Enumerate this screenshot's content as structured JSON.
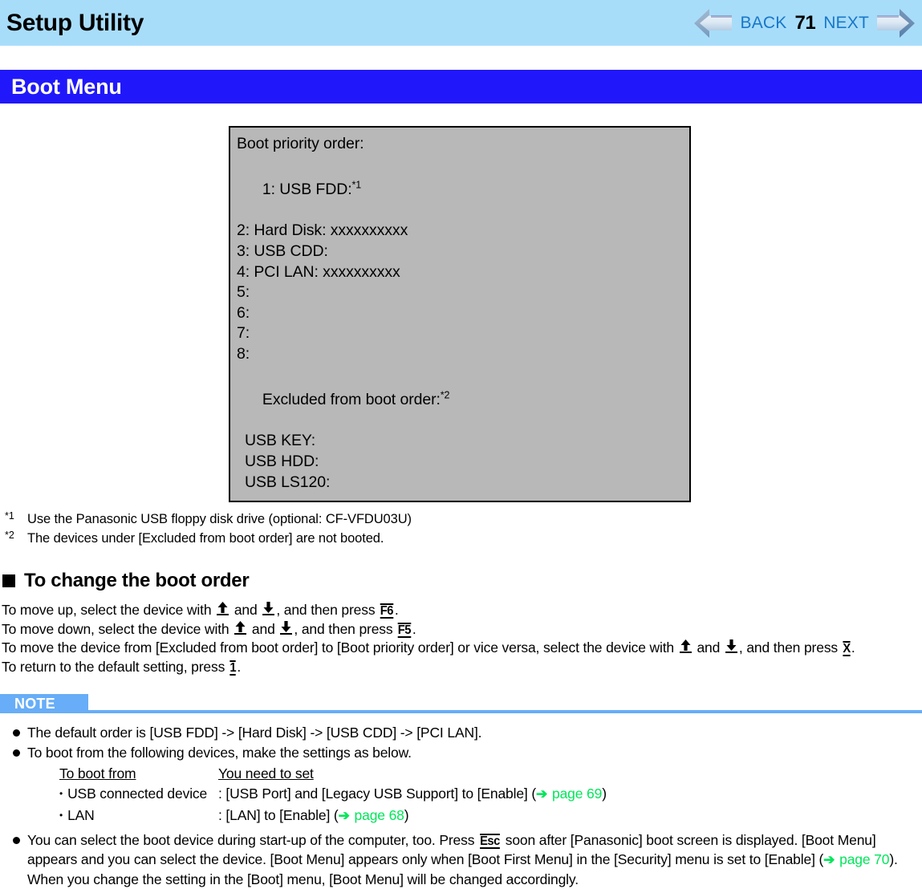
{
  "header": {
    "title": "Setup Utility",
    "back_label": "BACK",
    "page_number": "71",
    "next_label": "NEXT",
    "bg_color": "#a8ddfa",
    "link_color": "#1878c8"
  },
  "section": {
    "title": "Boot Menu",
    "bar_color": "#2018fa"
  },
  "bios_box": {
    "bg_color": "#b8b8b8",
    "heading": "Boot priority order:",
    "entries": [
      {
        "text": "1: USB FDD:",
        "sup": "*1"
      },
      {
        "text": "2: Hard Disk: xxxxxxxxxx",
        "sup": ""
      },
      {
        "text": "3: USB CDD:",
        "sup": ""
      },
      {
        "text": "4: PCI LAN: xxxxxxxxxx",
        "sup": ""
      },
      {
        "text": "5:",
        "sup": ""
      },
      {
        "text": "6:",
        "sup": ""
      },
      {
        "text": "7:",
        "sup": ""
      },
      {
        "text": "8:",
        "sup": ""
      }
    ],
    "excluded_heading": "Excluded from boot order:",
    "excluded_sup": "*2",
    "excluded_items": [
      "USB KEY:",
      "USB HDD:",
      "USB LS120:"
    ]
  },
  "footnotes": [
    {
      "mark": "*1",
      "text": "Use the Panasonic USB floppy disk drive (optional: CF-VFDU03U)"
    },
    {
      "mark": "*2",
      "text": "The devices under [Excluded from boot order] are not booted."
    }
  ],
  "subheading": {
    "text": "To change the boot order"
  },
  "instructions": {
    "line1_a": "To move up, select the device with ",
    "line1_and": " and ",
    "line1_b": ", and then press ",
    "line1_key": "F6",
    "line1_end": ".",
    "line2_a": "To move down, select the device with ",
    "line2_and": " and ",
    "line2_b": ", and then press ",
    "line2_key": "F5",
    "line2_end": ".",
    "line3_a": "To move the device from [Excluded from boot order] to [Boot priority order] or vice versa, select the device with ",
    "line3_and": " and ",
    "line3_b": ", and then press ",
    "line3_key": "X",
    "line3_end": ".",
    "line4_a": "To return to the default setting, press ",
    "line4_key": "1",
    "line4_end": "."
  },
  "note": {
    "badge": "NOTE",
    "badge_color": "#67adf7",
    "items": [
      {
        "text": "The default order is [USB FDD] -> [Hard Disk] -> [USB CDD] -> [PCI LAN]."
      },
      {
        "text": "To boot from the following devices, make the settings as below."
      }
    ],
    "mini_table": {
      "header_a": "To boot from",
      "header_b": "You need to set",
      "rows": [
        {
          "device": "USB connected device",
          "setting_pre": ": [USB Port] and [Legacy USB Support] to [Enable] (",
          "link_arrow": "➔",
          "link_text": " page 69",
          "setting_post": ")"
        },
        {
          "device": "LAN",
          "setting_pre": ": [LAN] to [Enable] (",
          "link_arrow": "➔",
          "link_text": " page 68",
          "setting_post": ")"
        }
      ]
    },
    "last_item": {
      "part1": "You can select the boot device during start-up of the computer, too. Press ",
      "key": "Esc",
      "part2": " soon after [Panasonic] boot screen is displayed. [Boot Menu] appears and you can select the device. [Boot Menu] appears only when [Boot First Menu] in the [Security] menu is set to [Enable] (",
      "link_arrow": "➔",
      "link_text": " page 70",
      "part3": "). When you change the setting in the [Boot] menu, [Boot Menu] will be changed accordingly."
    },
    "link_color": "#00e65a"
  }
}
